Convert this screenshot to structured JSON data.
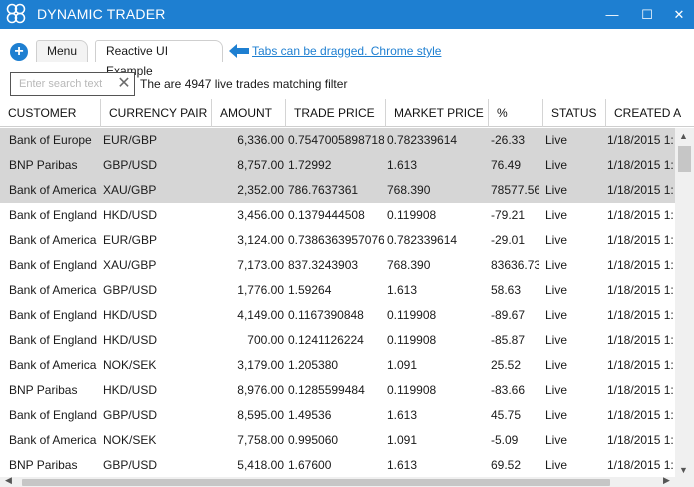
{
  "app": {
    "title": "DYNAMIC TRADER",
    "logo_icon": "infinity-logo-icon"
  },
  "window": {
    "minimize": "—",
    "maximize": "☐",
    "close": "✕"
  },
  "tabs": {
    "add_label": "+",
    "items": [
      {
        "label": "Menu"
      },
      {
        "label": "Reactive UI Example"
      }
    ],
    "hint": "Tabs can be dragged. Chrome style"
  },
  "filter": {
    "placeholder": "Enter search text",
    "clear_label": "✕",
    "status": "The are 4947 live trades matching filter"
  },
  "grid": {
    "columns": [
      "CUSTOMER",
      "CURRENCY PAIR",
      "AMOUNT",
      "TRADE PRICE",
      "MARKET PRICE",
      "%",
      "STATUS",
      "CREATED A"
    ],
    "rows": [
      {
        "selected": true,
        "customer": "Bank of Europe",
        "pair": "EUR/GBP",
        "amount": "6,336.00",
        "trade_price": "0.7547005898718",
        "market_price": "0.782339614",
        "pct": "-26.33",
        "status": "Live",
        "created": "1/18/2015 1:"
      },
      {
        "selected": true,
        "customer": "BNP Paribas",
        "pair": "GBP/USD",
        "amount": "8,757.00",
        "trade_price": "1.72992",
        "market_price": "1.613",
        "pct": "76.49",
        "status": "Live",
        "created": "1/18/2015 1:"
      },
      {
        "selected": true,
        "customer": "Bank of America",
        "pair": "XAU/GBP",
        "amount": "2,352.00",
        "trade_price": "786.7637361",
        "market_price": "768.390",
        "pct": "78577.56",
        "status": "Live",
        "created": "1/18/2015 1:"
      },
      {
        "selected": false,
        "customer": "Bank of England",
        "pair": "HKD/USD",
        "amount": "3,456.00",
        "trade_price": "0.1379444508",
        "market_price": "0.119908",
        "pct": "-79.21",
        "status": "Live",
        "created": "1/18/2015 1:"
      },
      {
        "selected": false,
        "customer": "Bank of America",
        "pair": "EUR/GBP",
        "amount": "3,124.00",
        "trade_price": "0.7386363957076",
        "market_price": "0.782339614",
        "pct": "-29.01",
        "status": "Live",
        "created": "1/18/2015 1:"
      },
      {
        "selected": false,
        "customer": "Bank of England",
        "pair": "XAU/GBP",
        "amount": "7,173.00",
        "trade_price": "837.3243903",
        "market_price": "768.390",
        "pct": "83636.73",
        "status": "Live",
        "created": "1/18/2015 1:"
      },
      {
        "selected": false,
        "customer": "Bank of America",
        "pair": "GBP/USD",
        "amount": "1,776.00",
        "trade_price": "1.59264",
        "market_price": "1.613",
        "pct": "58.63",
        "status": "Live",
        "created": "1/18/2015 1:"
      },
      {
        "selected": false,
        "customer": "Bank of England",
        "pair": "HKD/USD",
        "amount": "4,149.00",
        "trade_price": "0.1167390848",
        "market_price": "0.119908",
        "pct": "-89.67",
        "status": "Live",
        "created": "1/18/2015 1:"
      },
      {
        "selected": false,
        "customer": "Bank of England",
        "pair": "HKD/USD",
        "amount": "700.00",
        "trade_price": "0.1241126224",
        "market_price": "0.119908",
        "pct": "-85.87",
        "status": "Live",
        "created": "1/18/2015 1:"
      },
      {
        "selected": false,
        "customer": "Bank of America",
        "pair": "NOK/SEK",
        "amount": "3,179.00",
        "trade_price": "1.205380",
        "market_price": "1.091",
        "pct": "25.52",
        "status": "Live",
        "created": "1/18/2015 1:"
      },
      {
        "selected": false,
        "customer": "BNP Paribas",
        "pair": "HKD/USD",
        "amount": "8,976.00",
        "trade_price": "0.1285599484",
        "market_price": "0.119908",
        "pct": "-83.66",
        "status": "Live",
        "created": "1/18/2015 1:"
      },
      {
        "selected": false,
        "customer": "Bank of England",
        "pair": "GBP/USD",
        "amount": "8,595.00",
        "trade_price": "1.49536",
        "market_price": "1.613",
        "pct": "45.75",
        "status": "Live",
        "created": "1/18/2015 1:"
      },
      {
        "selected": false,
        "customer": "Bank of America",
        "pair": "NOK/SEK",
        "amount": "7,758.00",
        "trade_price": "0.995060",
        "market_price": "1.091",
        "pct": "-5.09",
        "status": "Live",
        "created": "1/18/2015 1:"
      },
      {
        "selected": false,
        "customer": "BNP Paribas",
        "pair": "GBP/USD",
        "amount": "5,418.00",
        "trade_price": "1.67600",
        "market_price": "1.613",
        "pct": "69.52",
        "status": "Live",
        "created": "1/18/2015 1:"
      }
    ]
  },
  "scroll": {
    "up": "▲",
    "down": "▼",
    "left": "◀",
    "right": "▶"
  },
  "colors": {
    "accent": "#1e7fd1",
    "selected_row": "#d6d6d6"
  }
}
